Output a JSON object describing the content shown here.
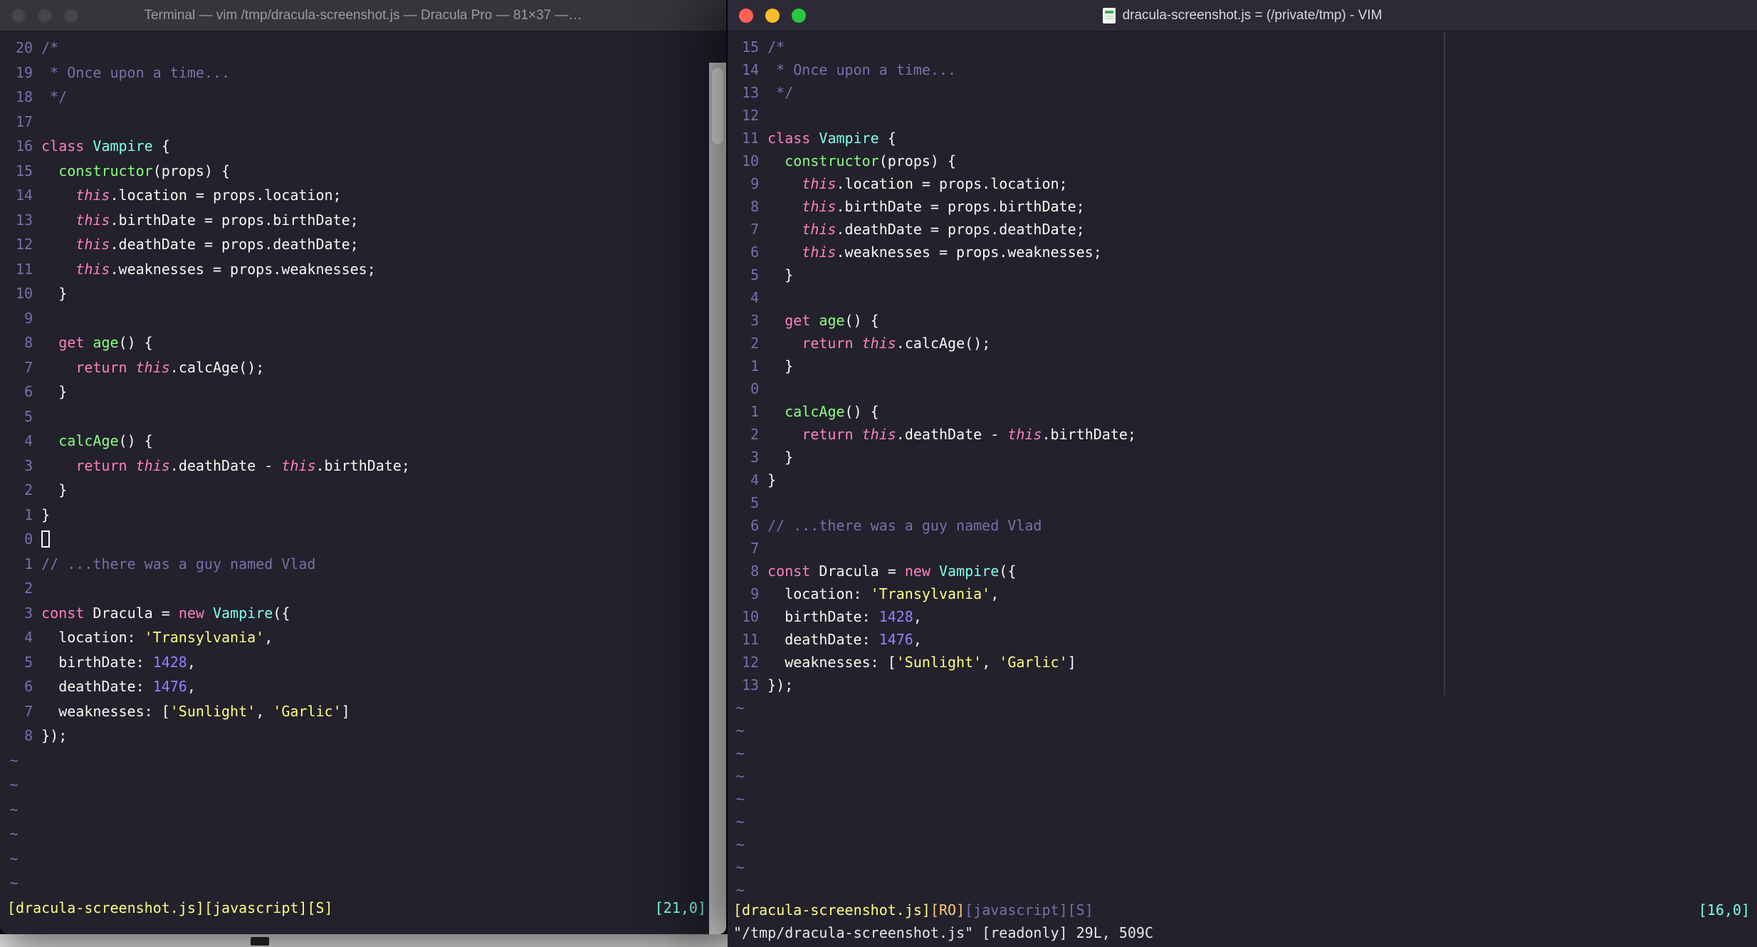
{
  "palette": {
    "bg": "#22212C",
    "fg": "#F8F8F2",
    "comment": "#7970A9",
    "pink": "#FF80BF",
    "green": "#8AFF80",
    "cyan": "#80FFEA",
    "yellow": "#FFFF80",
    "purple": "#9580FF",
    "orange": "#FFCA80",
    "trafficRed": "#FF5F57",
    "trafficYellow": "#FEBC2E",
    "trafficGreen": "#28C840",
    "trafficInactive": "#45464b"
  },
  "left_window": {
    "title": "Terminal — vim /tmp/dracula-screenshot.js — Dracula Pro — 81×37 —…",
    "status_left": "[dracula-screenshot.js][javascript][S]",
    "status_right": "[21,0]",
    "command_line": "",
    "cursor_row": 20,
    "cursor_style": "hollow",
    "tilde_rows": 6,
    "rel_numbers": [
      20,
      19,
      18,
      17,
      16,
      15,
      14,
      13,
      12,
      11,
      10,
      9,
      8,
      7,
      6,
      5,
      4,
      3,
      2,
      1,
      0,
      1,
      2,
      3,
      4,
      5,
      6,
      7,
      8
    ]
  },
  "right_window": {
    "title": "dracula-screenshot.js = (/private/tmp) - VIM",
    "status_file": "[dracula-screenshot.js]",
    "status_ro": "[RO]",
    "status_ft": "[javascript][S]",
    "status_right": "[16,0]",
    "command_line": "\"/tmp/dracula-screenshot.js\" [readonly] 29L, 509C",
    "cursor_row": 15,
    "cursor_style": "none",
    "tilde_rows": 9,
    "rel_numbers": [
      15,
      14,
      13,
      12,
      11,
      10,
      9,
      8,
      7,
      6,
      5,
      4,
      3,
      2,
      1,
      0,
      1,
      2,
      3,
      4,
      5,
      6,
      7,
      8,
      9,
      10,
      11,
      12,
      13
    ]
  },
  "code": {
    "tilde": "~",
    "lines": [
      [
        {
          "t": "/*",
          "c": "comment"
        }
      ],
      [
        {
          "t": " * Once upon a time...",
          "c": "comment"
        }
      ],
      [
        {
          "t": " */",
          "c": "comment"
        }
      ],
      [],
      [
        {
          "t": "class",
          "c": "pink"
        },
        {
          "t": " ",
          "c": "fg"
        },
        {
          "t": "Vampire",
          "c": "cyan"
        },
        {
          "t": " {",
          "c": "fg"
        }
      ],
      [
        {
          "t": "  ",
          "c": "fg"
        },
        {
          "t": "constructor",
          "c": "green"
        },
        {
          "t": "(props) {",
          "c": "fg"
        }
      ],
      [
        {
          "t": "    ",
          "c": "fg"
        },
        {
          "t": "this",
          "c": "pink",
          "i": true
        },
        {
          "t": ".location = props.location;",
          "c": "fg"
        }
      ],
      [
        {
          "t": "    ",
          "c": "fg"
        },
        {
          "t": "this",
          "c": "pink",
          "i": true
        },
        {
          "t": ".birthDate = props.birthDate;",
          "c": "fg"
        }
      ],
      [
        {
          "t": "    ",
          "c": "fg"
        },
        {
          "t": "this",
          "c": "pink",
          "i": true
        },
        {
          "t": ".deathDate = props.deathDate;",
          "c": "fg"
        }
      ],
      [
        {
          "t": "    ",
          "c": "fg"
        },
        {
          "t": "this",
          "c": "pink",
          "i": true
        },
        {
          "t": ".weaknesses = props.weaknesses;",
          "c": "fg"
        }
      ],
      [
        {
          "t": "  }",
          "c": "fg"
        }
      ],
      [],
      [
        {
          "t": "  ",
          "c": "fg"
        },
        {
          "t": "get",
          "c": "pink"
        },
        {
          "t": " ",
          "c": "fg"
        },
        {
          "t": "age",
          "c": "green"
        },
        {
          "t": "() {",
          "c": "fg"
        }
      ],
      [
        {
          "t": "    ",
          "c": "fg"
        },
        {
          "t": "return",
          "c": "pink"
        },
        {
          "t": " ",
          "c": "fg"
        },
        {
          "t": "this",
          "c": "pink",
          "i": true
        },
        {
          "t": ".calcAge();",
          "c": "fg"
        }
      ],
      [
        {
          "t": "  }",
          "c": "fg"
        }
      ],
      [],
      [
        {
          "t": "  ",
          "c": "fg"
        },
        {
          "t": "calcAge",
          "c": "green"
        },
        {
          "t": "() {",
          "c": "fg"
        }
      ],
      [
        {
          "t": "    ",
          "c": "fg"
        },
        {
          "t": "return",
          "c": "pink"
        },
        {
          "t": " ",
          "c": "fg"
        },
        {
          "t": "this",
          "c": "pink",
          "i": true
        },
        {
          "t": ".deathDate - ",
          "c": "fg"
        },
        {
          "t": "this",
          "c": "pink",
          "i": true
        },
        {
          "t": ".birthDate;",
          "c": "fg"
        }
      ],
      [
        {
          "t": "  }",
          "c": "fg"
        }
      ],
      [
        {
          "t": "}",
          "c": "fg"
        }
      ],
      [],
      [
        {
          "t": "// ...there was a guy named Vlad",
          "c": "comment"
        }
      ],
      [],
      [
        {
          "t": "const",
          "c": "pink"
        },
        {
          "t": " Dracula = ",
          "c": "fg"
        },
        {
          "t": "new",
          "c": "pink"
        },
        {
          "t": " ",
          "c": "fg"
        },
        {
          "t": "Vampire",
          "c": "cyan"
        },
        {
          "t": "({",
          "c": "fg"
        }
      ],
      [
        {
          "t": "  location: ",
          "c": "fg"
        },
        {
          "t": "'Transylvania'",
          "c": "yellow"
        },
        {
          "t": ",",
          "c": "fg"
        }
      ],
      [
        {
          "t": "  birthDate: ",
          "c": "fg"
        },
        {
          "t": "1428",
          "c": "purple"
        },
        {
          "t": ",",
          "c": "fg"
        }
      ],
      [
        {
          "t": "  deathDate: ",
          "c": "fg"
        },
        {
          "t": "1476",
          "c": "purple"
        },
        {
          "t": ",",
          "c": "fg"
        }
      ],
      [
        {
          "t": "  weaknesses: [",
          "c": "fg"
        },
        {
          "t": "'Sunlight'",
          "c": "yellow"
        },
        {
          "t": ", ",
          "c": "fg"
        },
        {
          "t": "'Garlic'",
          "c": "yellow"
        },
        {
          "t": "]",
          "c": "fg"
        }
      ],
      [
        {
          "t": "});",
          "c": "fg"
        }
      ]
    ]
  }
}
